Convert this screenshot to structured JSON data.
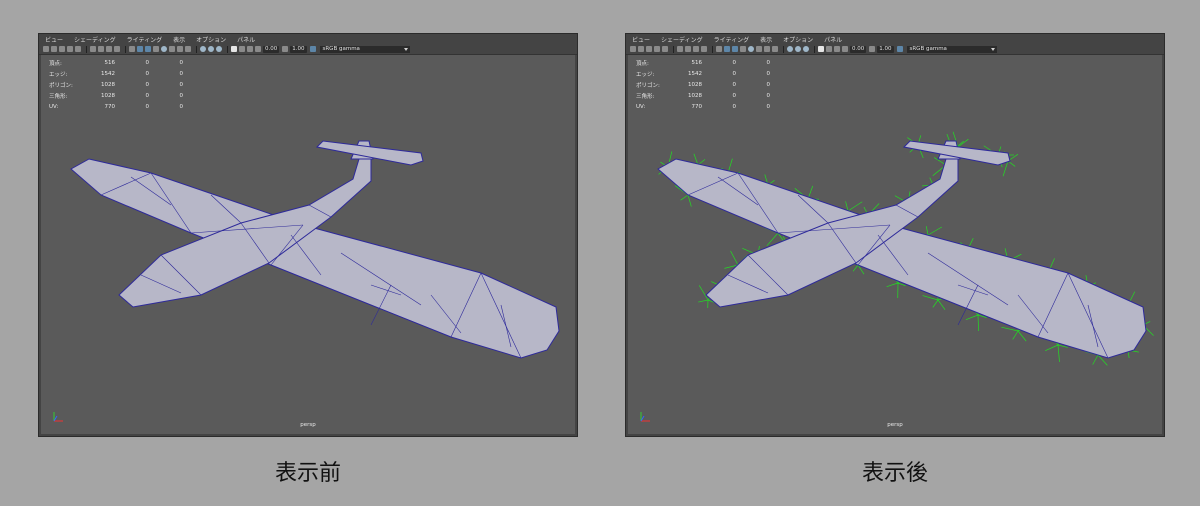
{
  "menu": [
    "ビュー",
    "シェーディング",
    "ライティング",
    "表示",
    "オプション",
    "パネル"
  ],
  "toolbar": {
    "field1": "0.00",
    "field2": "1.00",
    "color_space": "sRGB gamma"
  },
  "stats": [
    {
      "label": "頂点:",
      "v1": "516",
      "v2": "0",
      "v3": "0"
    },
    {
      "label": "エッジ:",
      "v1": "1542",
      "v2": "0",
      "v3": "0"
    },
    {
      "label": "ポリゴン:",
      "v1": "1028",
      "v2": "0",
      "v3": "0"
    },
    {
      "label": "三角形:",
      "v1": "1028",
      "v2": "0",
      "v3": "0"
    },
    {
      "label": "UV:",
      "v1": "770",
      "v2": "0",
      "v3": "0"
    }
  ],
  "camera_label": "persp",
  "captions": {
    "before": "表示前",
    "after": "表示後"
  },
  "colors": {
    "background": "#a5a5a5",
    "viewport": "#5a5a5a",
    "wire": "#2e2a9a",
    "surface": "#b7b7c8",
    "normals": "#22dd22"
  }
}
